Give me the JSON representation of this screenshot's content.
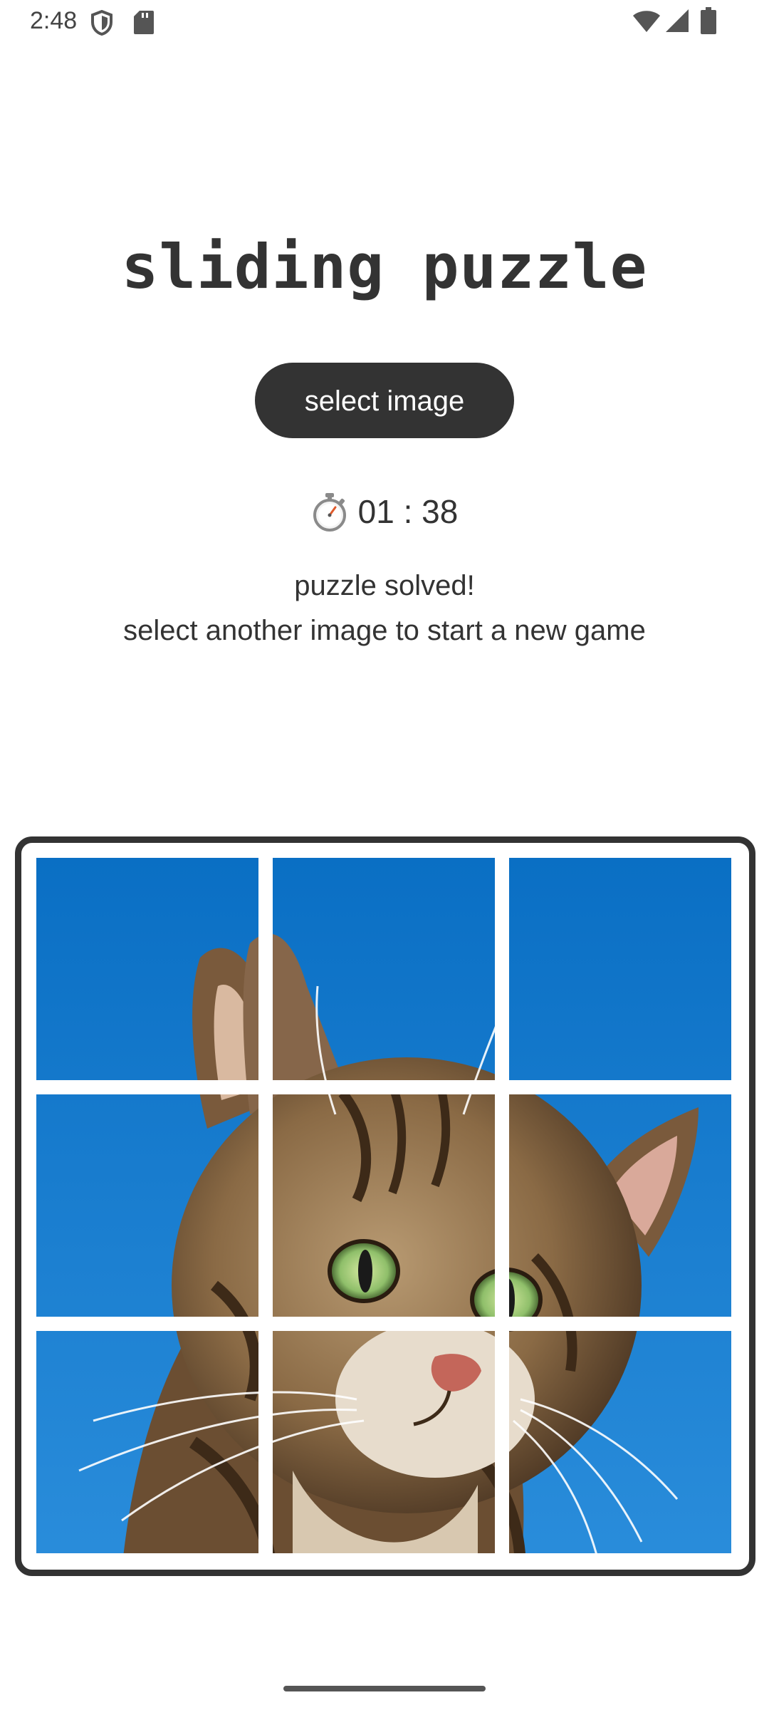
{
  "status_bar": {
    "time": "2:48",
    "icons": [
      "shield-icon",
      "sd-card-icon",
      "wifi-icon",
      "cell-signal-icon",
      "battery-icon"
    ]
  },
  "app": {
    "title": "sliding puzzle",
    "select_button_label": "select image",
    "timer_icon": "stopwatch-icon",
    "timer_text": "01 : 38",
    "status_line1": "puzzle solved!",
    "status_line2": "select another image to start a new game"
  },
  "board": {
    "grid": "3x3",
    "image_subject": "tabby cat against blue sky",
    "solved": true,
    "tile_order": [
      1,
      2,
      3,
      4,
      5,
      6,
      7,
      8,
      9
    ]
  },
  "colors": {
    "primary_dark": "#333333",
    "sky_blue": "#0a74c8",
    "background": "#ffffff"
  }
}
